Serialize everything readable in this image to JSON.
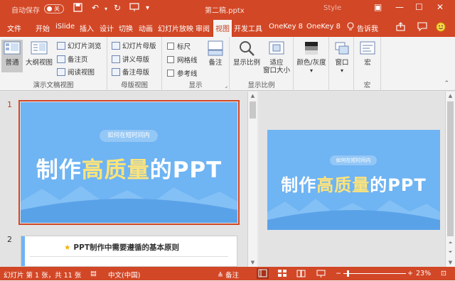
{
  "titlebar": {
    "autosave_label": "自动保存",
    "toggle_state": "关",
    "doc_title": "第二稿.pptx",
    "style_label": "Style"
  },
  "tabs": [
    "文件",
    "开始",
    "iSlide",
    "插入",
    "设计",
    "切换",
    "动画",
    "幻灯片放映",
    "审阅",
    "视图",
    "开发工具",
    "OneKey 8",
    "OneKey 8"
  ],
  "active_tab": "视图",
  "tell_me": "告诉我",
  "ribbon": {
    "views": {
      "normal": "普通",
      "outline": "大纲视图",
      "sorter": "幻灯片浏览",
      "notes_page": "备注页",
      "reading": "阅读视图",
      "label": "演示文稿视图"
    },
    "master": {
      "slide_master": "幻灯片母版",
      "handout_master": "讲义母版",
      "notes_master": "备注母版",
      "label": "母版视图"
    },
    "show": {
      "ruler": "标尺",
      "gridlines": "网格线",
      "guides": "参考线",
      "label": "显示"
    },
    "notes": "备注",
    "zoom": {
      "zoom": "显示比例",
      "fit_line1": "适应",
      "fit_line2": "窗口大小",
      "label": "显示比例"
    },
    "color": "颜色/灰度",
    "window": "窗口",
    "macros": {
      "macro": "宏",
      "label": "宏"
    }
  },
  "thumbnails": [
    {
      "number": "1",
      "subtitle": "如何在短时间内",
      "title_pre": "制作",
      "title_hl": "高质量",
      "title_post": "的PPT"
    },
    {
      "number": "2",
      "title": "PPT制作中需要遵循的基本原则"
    }
  ],
  "main_slide": {
    "subtitle": "如何在短时间内",
    "title_pre": "制作",
    "title_hl": "高质量",
    "title_post": "的PPT"
  },
  "status": {
    "slide_info": "幻灯片 第 1 张，共 11 张",
    "language": "中文(中国)",
    "notes": "备注",
    "zoom_pct": "23%",
    "zoom_level_percent": 23
  }
}
